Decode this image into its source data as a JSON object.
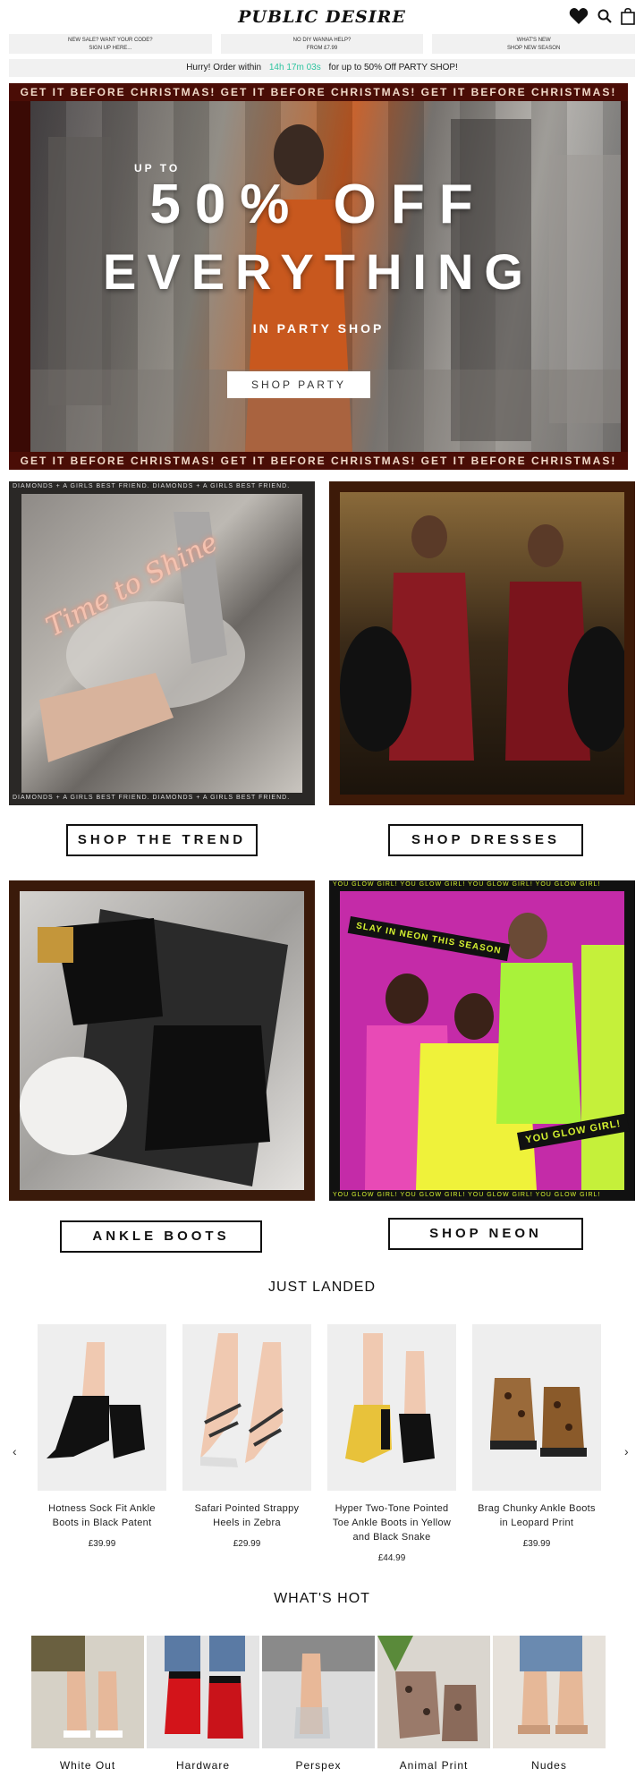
{
  "header": {
    "logo": "PUBLIC DESIRE",
    "icons": [
      "heart-icon",
      "search-icon",
      "bag-icon"
    ]
  },
  "promos": [
    {
      "title": "NEW SALE? WANT YOUR CODE?",
      "sub": "SIGN UP HERE..."
    },
    {
      "title": "NO DIY WANNA HELP?",
      "sub": "FROM £7.99"
    },
    {
      "title": "WHAT'S NEW",
      "sub": "SHOP NEW SEASON"
    }
  ],
  "hurry": {
    "pre": "Hurry! Order within",
    "timer": "14h 17m 03s",
    "post": "for up to 50% Off PARTY SHOP!"
  },
  "hero": {
    "ticker": "GET IT BEFORE CHRISTMAS! GET IT BEFORE CHRISTMAS! GET IT BEFORE CHRISTMAS!",
    "upto": "UP TO",
    "line1": "50% OFF",
    "line2": "EVERYTHING",
    "sub": "IN PARTY SHOP",
    "button": "SHOP PARTY"
  },
  "tiles": {
    "trend": {
      "ticker": "DIAMONDS + A GIRLS BEST FRIEND. DIAMONDS + A GIRLS BEST FRIEND.",
      "script": "Time to Shine",
      "button": "SHOP THE TREND"
    },
    "dresses": {
      "button": "SHOP DRESSES"
    },
    "boots": {
      "button": "ANKLE BOOTS"
    },
    "neon": {
      "ticker": "YOU GLOW GIRL! YOU GLOW GIRL! YOU GLOW GIRL! YOU GLOW GIRL!",
      "badge1": "SLAY IN NEON THIS SEASON",
      "badge2": "YOU GLOW GIRL!",
      "button": "SHOP NEON"
    }
  },
  "just_landed": {
    "title": "JUST LANDED",
    "products": [
      {
        "name": "Hotness Sock Fit Ankle Boots in Black Patent",
        "price": "£39.99"
      },
      {
        "name": "Safari Pointed Strappy Heels in Zebra",
        "price": "£29.99"
      },
      {
        "name": "Hyper Two-Tone Pointed Toe Ankle Boots in Yellow and Black Snake",
        "price": "£44.99"
      },
      {
        "name": "Brag Chunky Ankle Boots in Leopard Print",
        "price": "£39.99"
      }
    ],
    "prev": "‹",
    "next": "›"
  },
  "whats_hot": {
    "title": "WHAT'S HOT",
    "items": [
      "White Out",
      "Hardware",
      "Perspex",
      "Animal Print",
      "Nudes"
    ]
  }
}
